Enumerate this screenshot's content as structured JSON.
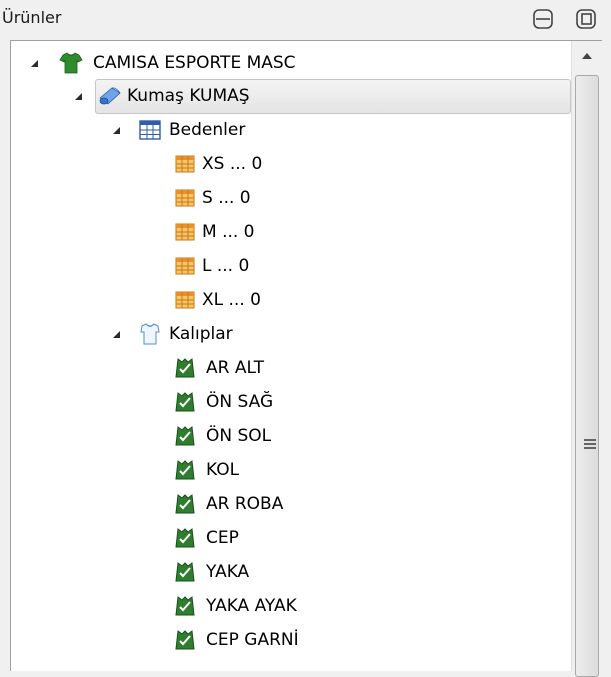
{
  "panel": {
    "title": "Ürünler"
  },
  "tree": {
    "root": {
      "label": "CAMISA ESPORTE MASC",
      "icon": "shirt-icon"
    },
    "fabric": {
      "label": "Kumaş KUMAŞ",
      "icon": "fabric-roll-icon",
      "selected": true
    },
    "sizes_group": {
      "label": "Bedenler",
      "icon": "table-icon"
    },
    "sizes": [
      {
        "label": "XS ... 0",
        "icon": "grid-item-icon"
      },
      {
        "label": "S ... 0",
        "icon": "grid-item-icon"
      },
      {
        "label": "M ... 0",
        "icon": "grid-item-icon"
      },
      {
        "label": "L ... 0",
        "icon": "grid-item-icon"
      },
      {
        "label": "XL ... 0",
        "icon": "grid-item-icon"
      }
    ],
    "patterns_group": {
      "label": "Kalıplar",
      "icon": "pattern-shirt-outline-icon"
    },
    "patterns": [
      {
        "label": "AR ALT",
        "icon": "pattern-piece-icon"
      },
      {
        "label": "ÖN SAĞ",
        "icon": "pattern-piece-icon"
      },
      {
        "label": "ÖN SOL",
        "icon": "pattern-piece-icon"
      },
      {
        "label": "KOL",
        "icon": "pattern-piece-icon"
      },
      {
        "label": "AR ROBA",
        "icon": "pattern-piece-icon"
      },
      {
        "label": "CEP",
        "icon": "pattern-piece-icon"
      },
      {
        "label": "YAKA",
        "icon": "pattern-piece-icon"
      },
      {
        "label": "YAKA AYAK",
        "icon": "pattern-piece-icon"
      },
      {
        "label": "CEP GARNİ",
        "icon": "pattern-piece-icon"
      }
    ]
  },
  "colors": {
    "shirt_green": "#2e8b2e",
    "fabric_blue": "#3a73c9",
    "table_blue": "#2f5ea8",
    "grid_orange": "#f2a33a",
    "pattern_green": "#2f7d2f"
  }
}
